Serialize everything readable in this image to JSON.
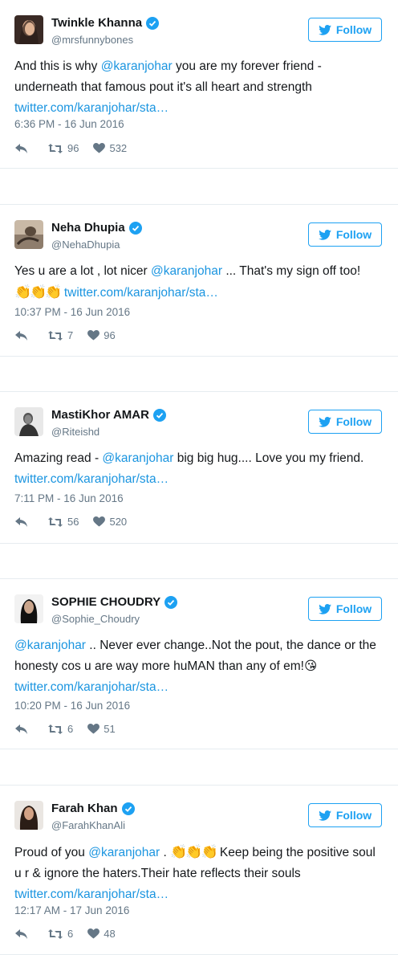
{
  "colors": {
    "accent": "#1da1f2",
    "link": "#1b95e0",
    "muted": "#657786"
  },
  "icons": {
    "verified": "verified-badge-icon",
    "bird": "twitter-bird-icon",
    "reply": "reply-icon",
    "retweet": "retweet-icon",
    "like": "heart-icon"
  },
  "follow_label": "Follow",
  "tweets": [
    {
      "name": "Twinkle Khanna",
      "handle": "@mrsfunnybones",
      "text_before": "And this is why ",
      "mention": "@karanjohar",
      "text_after": " you are my forever friend - underneath that famous pout it's all heart and strength ",
      "link": "twitter.com/karanjohar/sta…",
      "time": "6:36 PM - 16 Jun 2016",
      "retweets": "96",
      "likes": "532"
    },
    {
      "name": "Neha Dhupia",
      "handle": "@NehaDhupia",
      "text_before": "Yes u are a lot , lot nicer ",
      "mention": "@karanjohar",
      "text_after": " ... That's my sign off too! ",
      "emoji": "👏👏👏",
      "link": "twitter.com/karanjohar/sta…",
      "time": "10:37 PM - 16 Jun 2016",
      "retweets": "7",
      "likes": "96"
    },
    {
      "name": "MastiKhor AMAR",
      "handle": "@Riteishd",
      "text_before": "Amazing read - ",
      "mention": "@karanjohar",
      "text_after": " big big hug.... Love you my friend. ",
      "link": "twitter.com/karanjohar/sta…",
      "time": "7:11 PM - 16 Jun 2016",
      "retweets": "56",
      "likes": "520"
    },
    {
      "name": "SOPHIE CHOUDRY",
      "handle": "@Sophie_Choudry",
      "text_before": "",
      "mention": "@karanjohar",
      "text_after": " .. Never ever change..Not the pout, the dance or the honesty cos u are way more huMAN than any of em!",
      "emoji_after": "😘",
      "link": "twitter.com/karanjohar/sta…",
      "time": "10:20 PM - 16 Jun 2016",
      "retweets": "6",
      "likes": "51"
    },
    {
      "name": "Farah Khan",
      "handle": "@FarahKhanAli",
      "text_before": "Proud of you ",
      "mention": "@karanjohar",
      "text_after": " . ",
      "emoji": "👏👏👏",
      "text_after2": " Keep being the positive soul u r & ignore the haters.Their hate reflects their souls ",
      "link": "twitter.com/karanjohar/sta…",
      "time": "12:17 AM - 17 Jun 2016",
      "retweets": "6",
      "likes": "48"
    }
  ]
}
